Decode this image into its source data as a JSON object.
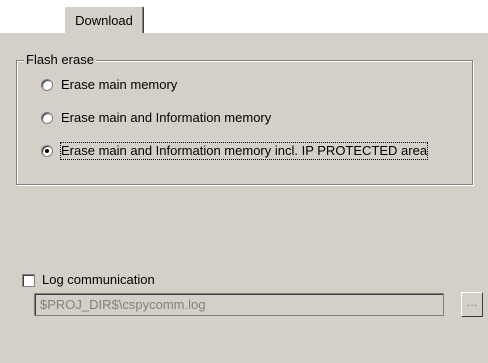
{
  "tabs": [
    {
      "label": "Download",
      "active": true
    }
  ],
  "flash_erase": {
    "title": "Flash erase",
    "options": [
      {
        "label": "Erase main memory",
        "selected": false
      },
      {
        "label": "Erase main and Information memory",
        "selected": false
      },
      {
        "label": "Erase main and Information memory incl. IP PROTECTED area",
        "selected": true
      }
    ]
  },
  "log_communication": {
    "label": "Log communication",
    "checked": false,
    "path_value": "$PROJ_DIR$\\cspycomm.log",
    "browse_label": "..."
  },
  "colors": {
    "dialog_background": "#d4d0c8",
    "disabled_text": "#808080"
  }
}
